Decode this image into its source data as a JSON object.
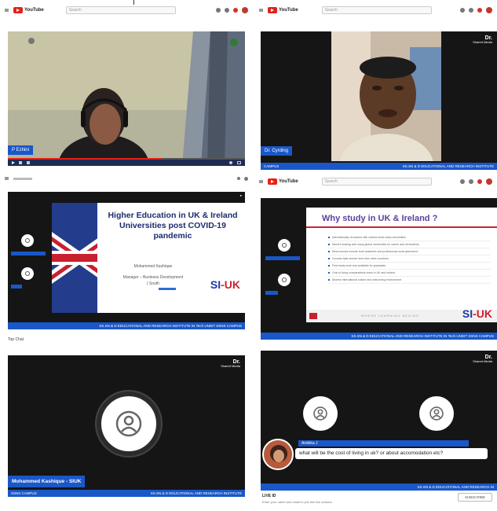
{
  "panels": {
    "p1": {
      "name_tag": "P Ezhini",
      "search_placeholder": "Search"
    },
    "p2": {
      "name_tag": "Dr. Cyrding",
      "strip_left": "CAMPUS",
      "strip_right": "SS.SN & D EDUCATIONAL AND RESEARCH INSTITUTE",
      "search_placeholder": "Search",
      "channel_logo": "Dr.",
      "channel_sub": "Shared Media"
    },
    "p3": {
      "slide_title": "Higher Education in UK & Ireland Universities post COVID-19 pandemic",
      "presenter": "Mohammed Kashique",
      "presenter_role": "Manager – Business Development",
      "presenter_role2": "( South",
      "brand_si": "SI",
      "brand_uk": "-UK",
      "strip": "SS.SN & D EDUCATIONAL AND RESEARCH INSTITUTE IN Tech UNDIT SSNS CAMPUS",
      "below": "Top Chat"
    },
    "p4": {
      "slide_title": "Why study in UK & Ireland ?",
      "bullets": [
        "Internationally renowned with ranked world-class universities",
        "World's leading with many global universities for career and all students",
        "Most courses include both academic and professional work placement",
        "Courses take shorter time than other countries",
        "Post study work visa available for graduates",
        "Cost of living comparatively lower in UK and Ireland",
        "Diverse international culture and welcoming environment"
      ],
      "brand_si": "SI",
      "brand_uk": "-UK",
      "tagline": "WHERE LEARNING BEGINS",
      "strip": "SS.SN & D EDUCATIONAL AND RESEARCH INSTITUTE IN Tech UNDIT SSNS CAMPUS",
      "search_placeholder": "Search"
    },
    "p5": {
      "name_tag": "Mohammed Kashique - SIUK",
      "strip_left": "SSNS CAMPUS",
      "strip_right": "SS.SN & D EDUCATIONAL AND RESEARCH INSTITUTE",
      "channel_logo": "Dr.",
      "channel_sub": "Shared Media"
    },
    "p6": {
      "chat_author": "Ambika J",
      "chat_text": "what will be the cost of living in uk? or about accomodation etc?",
      "strip_right": "SS.SN & D EDUCATIONAL AND RESEARCH IN",
      "below_title": "LIVE ID",
      "below_text": "Enter your name and email to join this live session",
      "subscribe": "SUBSCRIBE",
      "channel_logo": "Dr.",
      "channel_sub": "Shared Media"
    }
  },
  "colors": {
    "accent_blue": "#1a57c8",
    "youtube_red": "#e62117",
    "video_bg": "#111111"
  }
}
